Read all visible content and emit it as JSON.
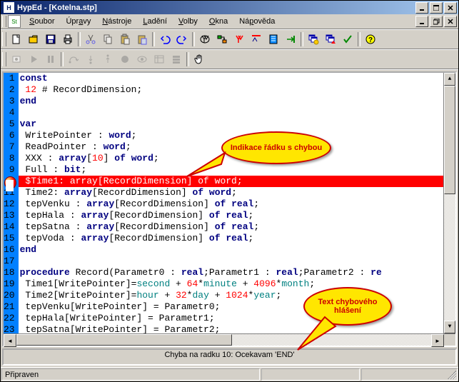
{
  "title": "HypEd - [Kotelna.stp]",
  "menu": {
    "soubor": "Soubor",
    "upravy": "Úpravy",
    "nastroje": "Nástroje",
    "ladeni": "Ladění",
    "volby": "Volby",
    "okna": "Okna",
    "napoveda": "Nápověda"
  },
  "toolbar1_icons": [
    "new-icon",
    "open-icon",
    "save-icon",
    "print-icon",
    "cut-icon",
    "copy-icon",
    "paste-icon",
    "paste-special-icon",
    "undo-icon",
    "redo-icon",
    "find-icon",
    "replace-icon",
    "find-next-icon",
    "find-prev-icon",
    "bookmark-icon",
    "goto-icon",
    "window-cascade-icon",
    "window-tile-icon",
    "check-icon",
    "help-icon"
  ],
  "toolbar2_icons": [
    "record-icon",
    "play-icon",
    "pause-icon",
    "step-over-icon",
    "step-into-icon",
    "step-out-icon",
    "breakpoint-icon",
    "watch-icon",
    "variables-icon",
    "callstack-icon",
    "hand-icon"
  ],
  "gutter_start": 1,
  "gutter_end": 23,
  "error_line_no": 10,
  "code": [
    {
      "n": 1,
      "html": "<span class='kw'>const</span>"
    },
    {
      "n": 2,
      "html": " <span class='num'>12</span> # RecordDimension;"
    },
    {
      "n": 3,
      "html": "<span class='kw'>end</span>"
    },
    {
      "n": 4,
      "html": ""
    },
    {
      "n": 5,
      "html": "<span class='kw'>var</span>"
    },
    {
      "n": 6,
      "html": " WritePointer : <span class='kw'>word</span>;"
    },
    {
      "n": 7,
      "html": " ReadPointer : <span class='kw'>word</span>;"
    },
    {
      "n": 8,
      "html": " XXX : <span class='kw'>array</span>[<span class='num'>10</span>] <span class='kw'>of</span> <span class='kw'>word</span>;"
    },
    {
      "n": 9,
      "html": " Full : <span class='kw'>bit</span>;"
    },
    {
      "n": 10,
      "html": " $Time1: array[RecordDimension] of word;"
    },
    {
      "n": 11,
      "html": " Time2: <span class='kw'>array</span>[RecordDimension] <span class='kw'>of</span> <span class='kw'>word</span>;"
    },
    {
      "n": 12,
      "html": " tepVenku : <span class='kw'>array</span>[RecordDimension] <span class='kw'>of</span> <span class='kw'>real</span>;"
    },
    {
      "n": 13,
      "html": " tepHala : <span class='kw'>array</span>[RecordDimension] <span class='kw'>of</span> <span class='kw'>real</span>;"
    },
    {
      "n": 14,
      "html": " tepSatna : <span class='kw'>array</span>[RecordDimension] <span class='kw'>of</span> <span class='kw'>real</span>;"
    },
    {
      "n": 15,
      "html": " tepVoda : <span class='kw'>array</span>[RecordDimension] <span class='kw'>of</span> <span class='kw'>real</span>;"
    },
    {
      "n": 16,
      "html": "<span class='kw'>end</span>"
    },
    {
      "n": 17,
      "html": ""
    },
    {
      "n": 18,
      "html": "<span class='kw'>procedure</span> Record(Parametr0 : <span class='kw'>real</span>;Parametr1 : <span class='kw'>real</span>;Parametr2 : <span class='kw'>re</span>"
    },
    {
      "n": 19,
      "html": " Time1[WritePointer]=<span class='str'>second</span> + <span class='num'>64</span>*<span class='str'>minute</span> + <span class='num'>4096</span>*<span class='str'>month</span>;"
    },
    {
      "n": 20,
      "html": " Time2[WritePointer]=<span class='str'>hour</span> + <span class='num'>32</span>*<span class='str'>day</span> + <span class='num'>1024</span>*<span class='str'>year</span>;"
    },
    {
      "n": 21,
      "html": " tepVenku[WritePointer] = Parametr0;"
    },
    {
      "n": 22,
      "html": " tepHala[WritePointer] = Parametr1;"
    },
    {
      "n": 23,
      "html": " tepSatna[WritePointer] = Parametr2;"
    }
  ],
  "error_panel": "Chyba na radku 10: Ocekavam 'END'",
  "status": {
    "ready": "Připraven"
  },
  "callout1": "Indikace řádku s chybou",
  "callout2": "Text chybového hlášení"
}
